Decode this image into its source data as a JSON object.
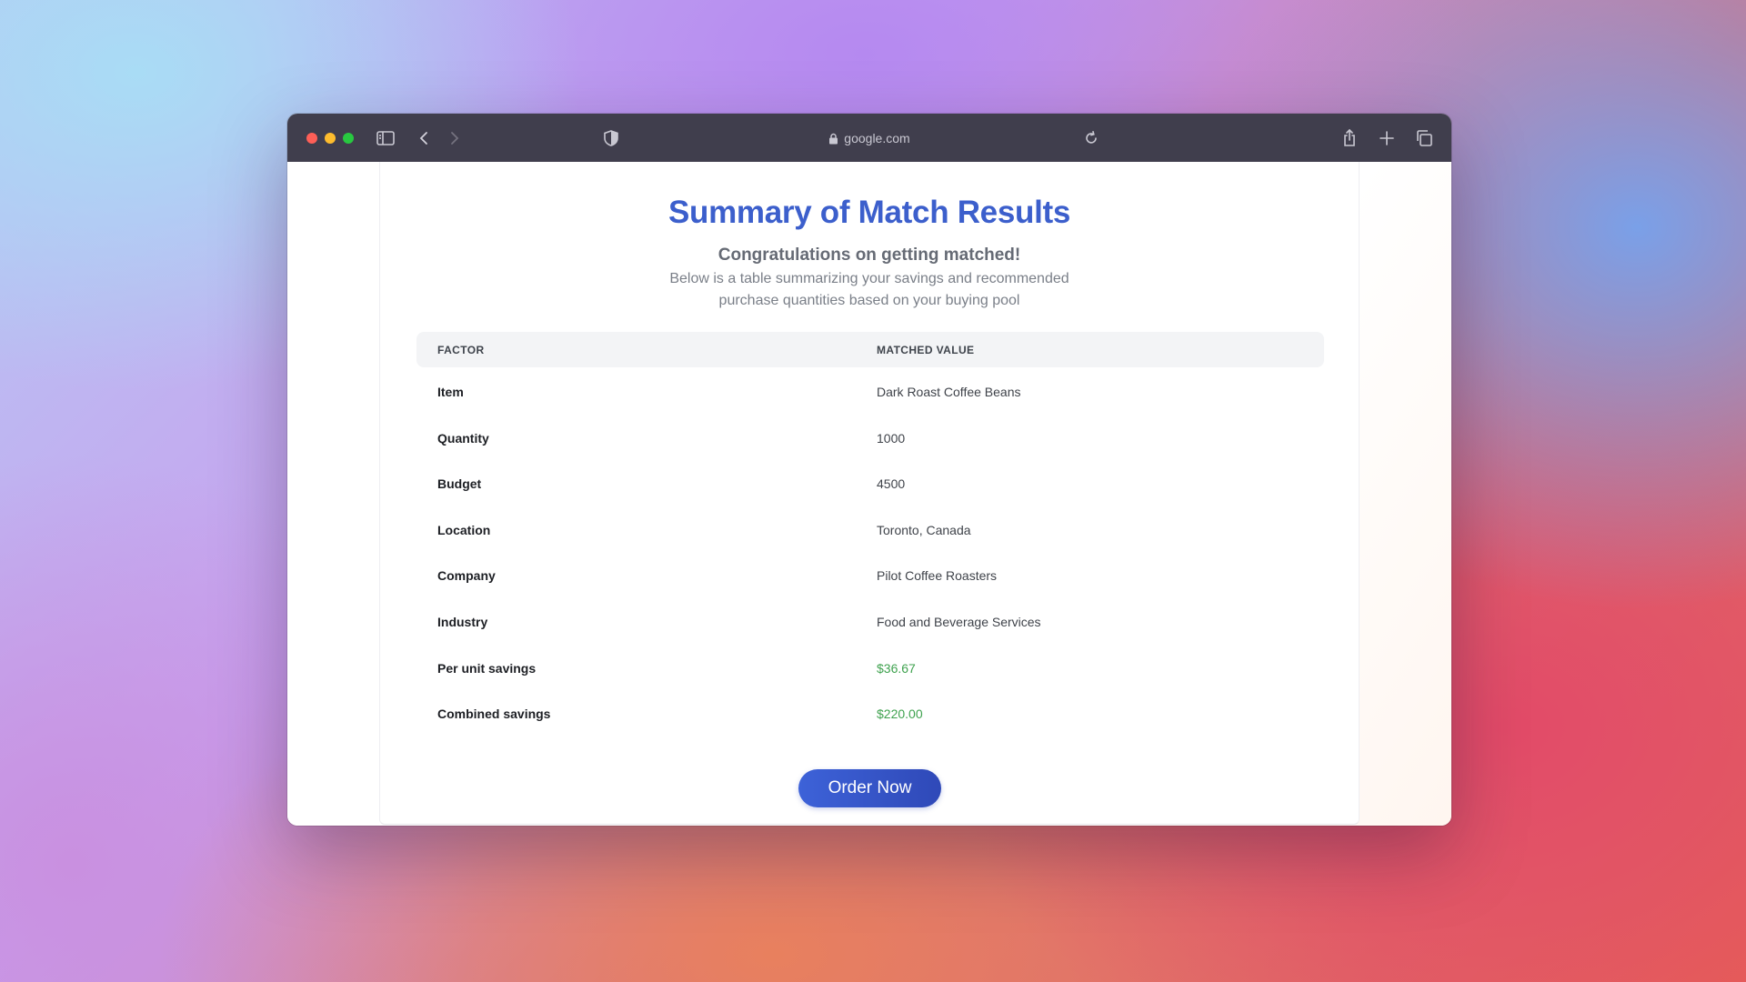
{
  "browser": {
    "url": "google.com",
    "icons": {
      "sidebar": "sidebar-icon",
      "back": "chevron-left-icon",
      "forward": "chevron-right-icon",
      "privacy": "shield-icon",
      "lock": "lock-icon",
      "reload": "reload-icon",
      "share": "share-icon",
      "new_tab": "plus-icon",
      "tabs": "tabs-overview-icon"
    }
  },
  "page": {
    "title": "Summary of Match Results",
    "subtitle": "Congratulations on getting matched!",
    "description": "Below is a table summarizing your savings and recommended purchase quantities based on your buying pool",
    "table": {
      "headers": [
        "FACTOR",
        "MATCHED VALUE"
      ],
      "rows": [
        {
          "factor": "Item",
          "value": "Dark Roast Coffee Beans"
        },
        {
          "factor": "Quantity",
          "value": "1000"
        },
        {
          "factor": "Budget",
          "value": "4500"
        },
        {
          "factor": "Location",
          "value": "Toronto, Canada"
        },
        {
          "factor": "Company",
          "value": "Pilot Coffee Roasters"
        },
        {
          "factor": "Industry",
          "value": "Food and Beverage Services"
        },
        {
          "factor": "Per unit savings",
          "value": "$36.67"
        },
        {
          "factor": "Combined savings",
          "value": "$220.00"
        }
      ]
    },
    "order_button_label": "Order Now"
  },
  "colors": {
    "title": "#3c5fcc",
    "savings": "#3fa24f",
    "button": "#3550c8",
    "titlebar": "#403e4d"
  }
}
